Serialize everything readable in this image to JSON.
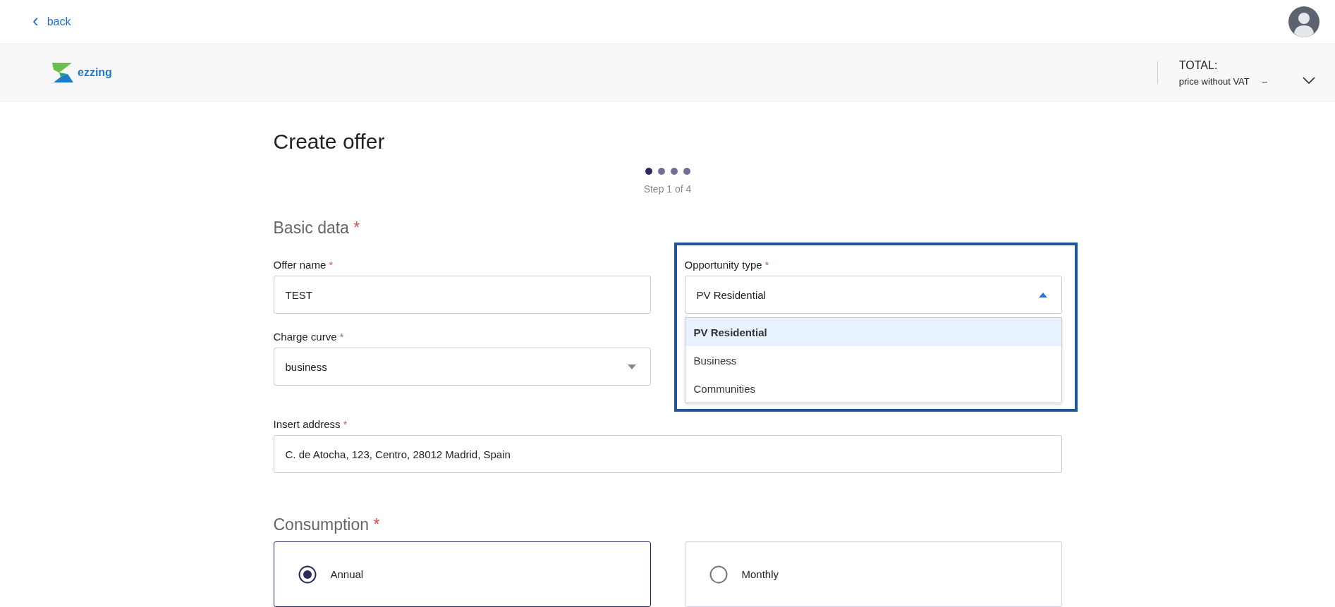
{
  "top_bar": {
    "back": {
      "icon": "‹",
      "label": "back"
    }
  },
  "header": {
    "logo_text": "ezzing",
    "total": {
      "title": "TOTAL:",
      "subtitle": "price without VAT",
      "value": "–",
      "expanded": false
    }
  },
  "page": {
    "title": "Create offer",
    "steps": [
      {
        "selected": true
      },
      {
        "selected": false
      },
      {
        "selected": false
      },
      {
        "selected": false
      }
    ],
    "step_label": "Step 1 of 4",
    "basic_data": {
      "heading": "Basic data",
      "mark": "*",
      "offer_name": {
        "label": "Offer name",
        "mark": "*",
        "value": "TEST"
      },
      "opportunity_type": {
        "label": "Opportunity type",
        "mark": "*",
        "value": "PV Residential",
        "expanded": true,
        "highlighted": true,
        "options": [
          {
            "label": "PV Residential",
            "selected": true
          },
          {
            "label": "Business",
            "selected": false
          },
          {
            "label": "Communities",
            "selected": false
          }
        ]
      },
      "charge_curve": {
        "label": "Charge curve",
        "mark": "*",
        "value": "business",
        "expanded": false
      },
      "address": {
        "label": "Insert address",
        "mark": "*",
        "value": "C. de Atocha, 123, Centro, 28012 Madrid, Spain"
      }
    },
    "consumption": {
      "heading": "Consumption",
      "mark": "*",
      "options": [
        {
          "label": "Annual",
          "selected": true
        },
        {
          "label": "Monthly",
          "selected": false
        }
      ]
    }
  }
}
